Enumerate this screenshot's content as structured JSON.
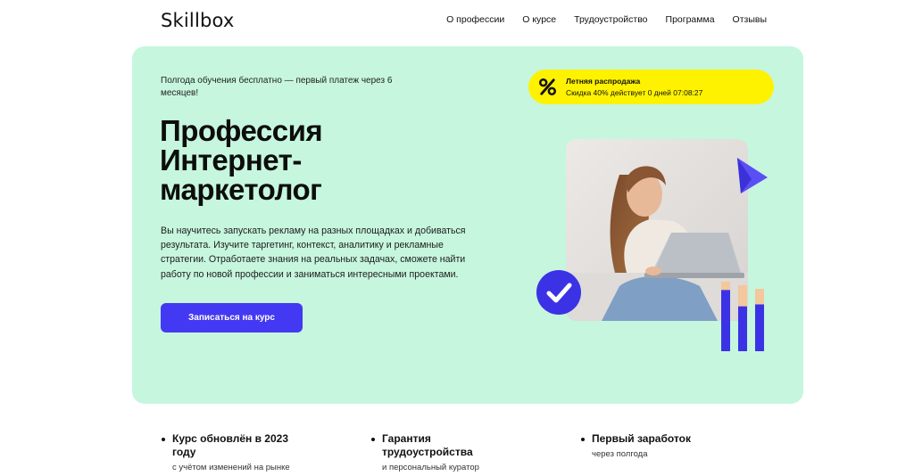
{
  "header": {
    "logo": "Skillbox",
    "nav": [
      {
        "label": "О профессии"
      },
      {
        "label": "О курсе"
      },
      {
        "label": "Трудоустройство"
      },
      {
        "label": "Программа"
      },
      {
        "label": "Отзывы"
      }
    ]
  },
  "hero": {
    "installment": "Полгода обучения бесплатно — первый платеж через 6 месяцев!",
    "title_lines": [
      "Профессия",
      "Интернет-",
      "маркетолог"
    ],
    "description": "Вы научитесь запускать рекламу на разных площадках и добиваться результата. Изучите таргетинг, контекст, аналитику и рекламные стратегии. Отработаете знания на реальных задачах, сможете найти работу по новой профессии и заниматься интересными проектами.",
    "cta_label": "Записаться на курс",
    "sale": {
      "icon": "percent-icon",
      "title": "Летняя распродажа",
      "text": "Скидка 40% действует 0 дней 07:08:27"
    }
  },
  "features": [
    {
      "title": "Курс обновлён в 2023 году",
      "subtitle": "с учётом изменений на рынке"
    },
    {
      "title": "Гарантия трудоустройства",
      "subtitle": "и персональный куратор"
    },
    {
      "title": "Первый заработок",
      "subtitle": "через полгода"
    }
  ],
  "colors": {
    "hero_bg": "#c6f6de",
    "accent": "#4339f2",
    "sale_bg": "#fff200"
  },
  "illustration": {
    "bar_levels": [
      0.88,
      0.68,
      0.75
    ]
  }
}
